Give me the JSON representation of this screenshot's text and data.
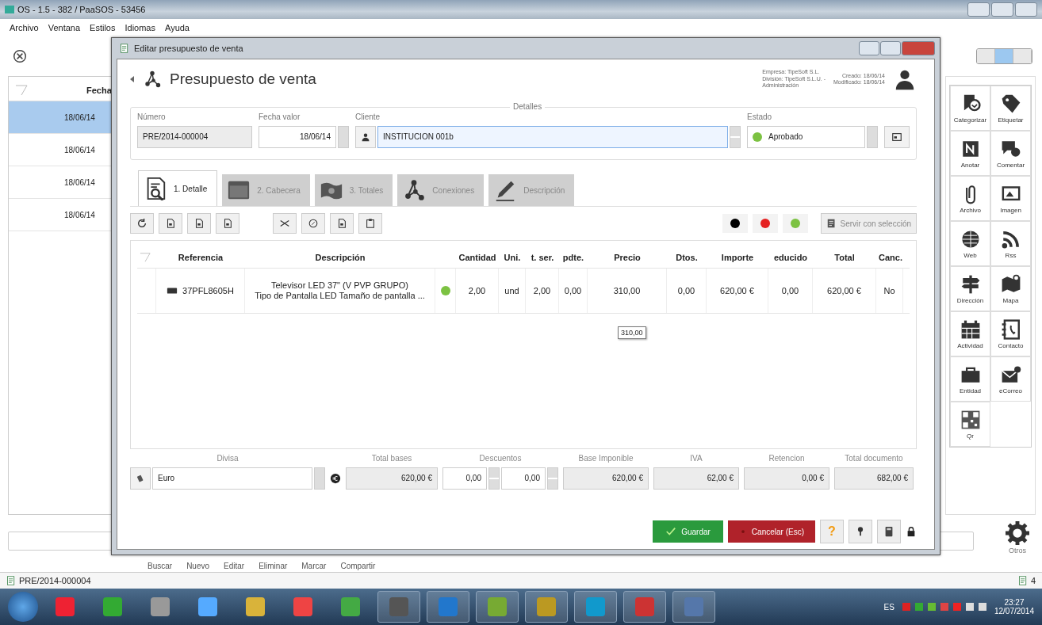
{
  "app": {
    "title": "OS - 1.5 - 382 / PaaSOS - 53456",
    "menu": [
      "Archivo",
      "Ventana",
      "Estilos",
      "Idiomas",
      "Ayuda"
    ]
  },
  "list": {
    "column": "Fecha",
    "rows": [
      {
        "date": "18/06/14",
        "selected": true
      },
      {
        "date": "18/06/14",
        "selected": false
      },
      {
        "date": "18/06/14",
        "selected": false
      },
      {
        "date": "18/06/14",
        "selected": false
      }
    ]
  },
  "side_panel": {
    "items": [
      "Categorizar",
      "Etiquetar",
      "Anotar",
      "Comentar",
      "Archivo",
      "Imagen",
      "Web",
      "Rss",
      "Dirección",
      "Mapa",
      "Actividad",
      "Contacto",
      "Entidad",
      "eCorreo",
      "Qr"
    ],
    "more": "Otros"
  },
  "bottom_toolbar": [
    "Buscar",
    "Nuevo",
    "Editar",
    "Eliminar",
    "Marcar",
    "Compartir"
  ],
  "status_bar": {
    "document": "PRE/2014-000004",
    "count": "4"
  },
  "taskbar": {
    "language": "ES",
    "time": "23:27",
    "date": "12/07/2014"
  },
  "dialog": {
    "title": "Editar presupuesto de venta",
    "heading": "Presupuesto de venta",
    "company": [
      "Empresa: TipeSoft S.L.",
      "División: TipeSoft S.L.U. -",
      "Administración"
    ],
    "dates": [
      "Creado: 18/06/14",
      "Modificado: 18/06/14"
    ],
    "details": {
      "legend": "Detalles",
      "numero": {
        "label": "Número",
        "value": "PRE/2014-000004"
      },
      "fecha": {
        "label": "Fecha valor",
        "value": "18/06/14"
      },
      "cliente": {
        "label": "Cliente",
        "value": "INSTITUCION 001b"
      },
      "estado": {
        "label": "Estado",
        "value": "Aprobado",
        "color": "#7cc242"
      }
    },
    "tabs": [
      {
        "label": "1. Detalle",
        "selected": true
      },
      {
        "label": "2. Cabecera",
        "selected": false
      },
      {
        "label": "3. Totales",
        "selected": false
      },
      {
        "label": "Conexiones",
        "selected": false
      },
      {
        "label": "Descripción",
        "selected": false
      }
    ],
    "color_filters": [
      {
        "color": "#000000"
      },
      {
        "color": "#e52222"
      },
      {
        "color": "#7cc242"
      }
    ],
    "serve_button": "Servir con selección",
    "table": {
      "columns": [
        "Referencia",
        "Descripción",
        "",
        "Cantidad",
        "Uni.",
        "t. ser.",
        "pdte.",
        "Precio",
        "Dtos.",
        "Importe",
        "educido",
        "Total",
        "Canc."
      ],
      "rows": [
        {
          "color": "#7cc242",
          "cells": [
            "37PFL8605H",
            "Televisor LED 37\" (V PVP GRUPO)\nTipo de Pantalla LED Tamaño de pantalla ...",
            "",
            "2,00",
            "und",
            "2,00",
            "0,00",
            "310,00",
            "0,00",
            "620,00 €",
            "0,00",
            "620,00 €",
            "No"
          ]
        }
      ]
    },
    "tooltip": "310,00",
    "totals": {
      "divisa": {
        "label": "Divisa",
        "value": "Euro"
      },
      "total_bases": {
        "label": "Total bases",
        "value": "620,00 €"
      },
      "descuentos": {
        "label": "Descuentos",
        "values": [
          "0,00",
          "0,00"
        ]
      },
      "base_imponible": {
        "label": "Base Imponible",
        "value": "620,00 €"
      },
      "iva": {
        "label": "IVA",
        "value": "62,00 €"
      },
      "retencion": {
        "label": "Retencion",
        "value": "0,00 €"
      },
      "total_documento": {
        "label": "Total documento",
        "value": "682,00 €"
      }
    },
    "buttons": {
      "save": "Guardar",
      "cancel": "Cancelar (Esc)",
      "help": "?"
    }
  }
}
